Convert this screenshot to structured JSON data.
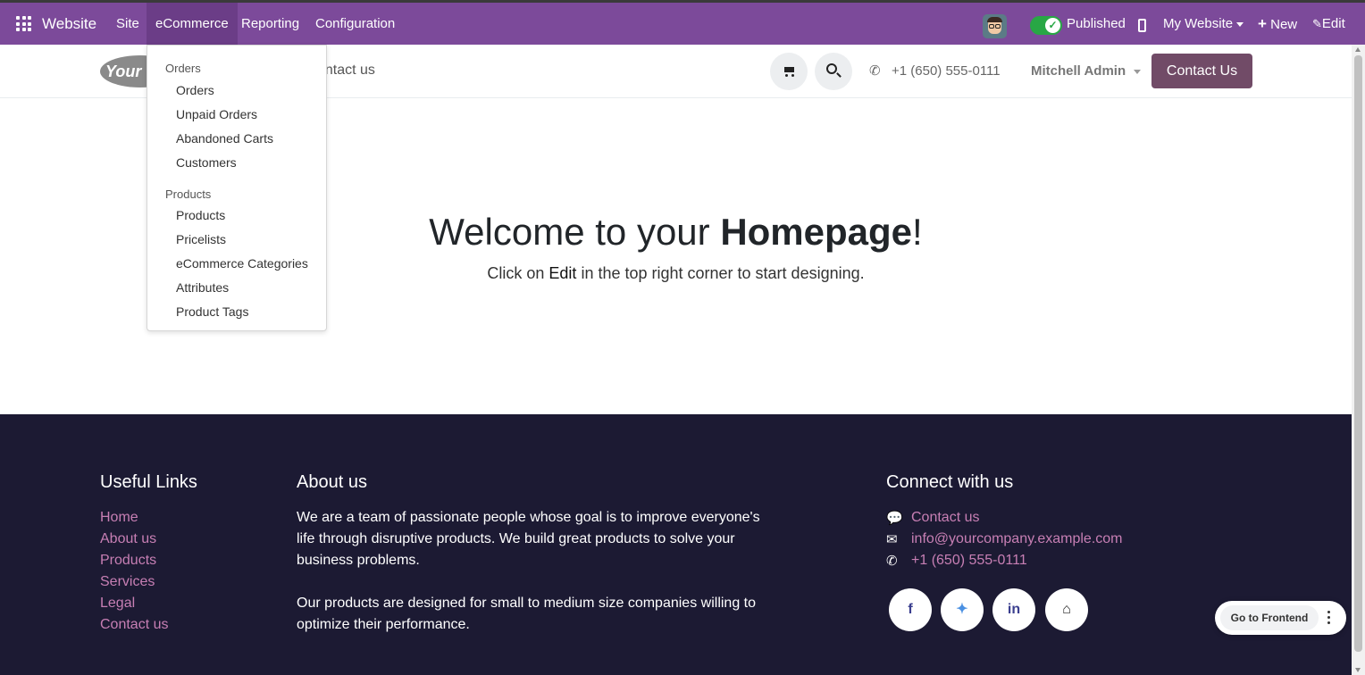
{
  "topbar": {
    "app_name": "Website",
    "menus": [
      "Site",
      "eCommerce",
      "Reporting",
      "Configuration"
    ],
    "published_label": "Published",
    "website_selector": "My Website",
    "new_label": "New",
    "edit_label": "Edit",
    "colors": {
      "bar": "#7c4a9a",
      "active_menu": "#6b3d87",
      "toggle_on": "#28a745"
    }
  },
  "header": {
    "logo_text": "Your",
    "nav_contact": "ontact us",
    "phone": "+1 (650) 555-0111",
    "user": "Mitchell Admin",
    "contact_button": "Contact Us",
    "accent": "#714b67"
  },
  "hero": {
    "title_prefix": "Welcome to your ",
    "title_bold": "Homepage",
    "title_suffix": "!",
    "sub_prefix": "Click on ",
    "sub_bold": "Edit",
    "sub_suffix": " in the top right corner to start designing."
  },
  "dropdown": {
    "sections": [
      {
        "header": "Orders",
        "items": [
          "Orders",
          "Unpaid Orders",
          "Abandoned Carts",
          "Customers"
        ]
      },
      {
        "header": "Products",
        "items": [
          "Products",
          "Pricelists",
          "eCommerce Categories",
          "Attributes",
          "Product Tags"
        ]
      }
    ]
  },
  "footer": {
    "useful_links_title": "Useful Links",
    "useful_links": [
      "Home",
      "About us",
      "Products",
      "Services",
      "Legal",
      "Contact us"
    ],
    "about_title": "About us",
    "about_p1": "We are a team of passionate people whose goal is to improve everyone's life through disruptive products. We build great products to solve your business problems.",
    "about_p2": "Our products are designed for small to medium size companies willing to optimize their performance.",
    "connect_title": "Connect with us",
    "connect": [
      {
        "icon": "comment-icon",
        "text": "Contact us"
      },
      {
        "icon": "envelope-icon",
        "text": "info@yourcompany.example.com"
      },
      {
        "icon": "phone-icon",
        "text": "+1 (650) 555-0111"
      }
    ],
    "social": [
      "facebook-icon",
      "twitter-icon",
      "linkedin-icon",
      "home-icon"
    ],
    "background": "#1c1a33",
    "link_color": "#c77fb4"
  },
  "frontend_button": "Go to Frontend"
}
